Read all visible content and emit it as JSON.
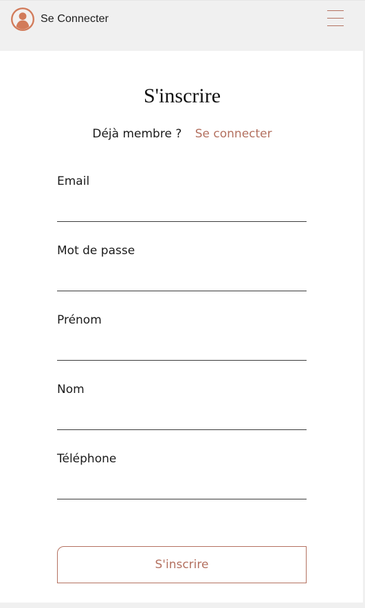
{
  "header": {
    "login_label": "Se Connecter",
    "avatar_icon": "user-avatar-icon",
    "menu_icon": "hamburger-menu-icon",
    "accent_color": "#b3705f",
    "avatar_color": "#d27b5a"
  },
  "form": {
    "title": "S'inscrire",
    "member_text": "Déjà membre ?",
    "member_link": "Se connecter",
    "fields": [
      {
        "label": "Email",
        "value": ""
      },
      {
        "label": "Mot de passe",
        "value": ""
      },
      {
        "label": "Prénom",
        "value": ""
      },
      {
        "label": "Nom",
        "value": ""
      },
      {
        "label": "Téléphone",
        "value": ""
      }
    ],
    "submit_label": "S'inscrire"
  }
}
